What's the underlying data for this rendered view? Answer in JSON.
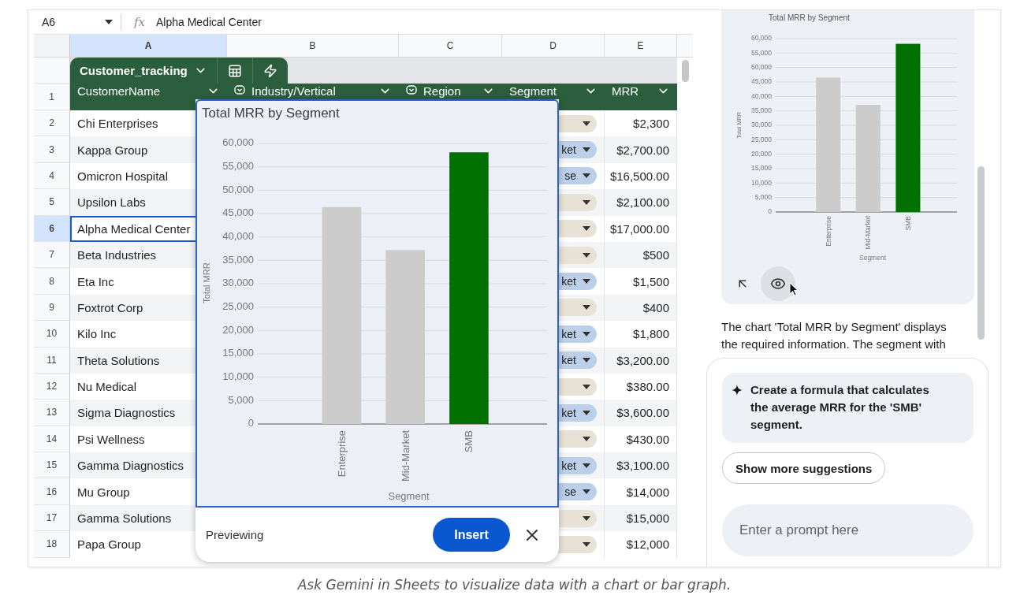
{
  "formula_bar": {
    "cell_ref": "A6",
    "function_label": "fx",
    "formula": "Alpha Medical Center"
  },
  "column_headers": [
    {
      "label": "A",
      "selected": true
    },
    {
      "label": "B",
      "selected": false
    },
    {
      "label": "C",
      "selected": false
    },
    {
      "label": "D",
      "selected": false
    },
    {
      "label": "E",
      "selected": false
    }
  ],
  "table": {
    "name": "Customer_tracking",
    "header_row_number": "1",
    "columns": [
      {
        "label": "CustomerName",
        "kind": "plain"
      },
      {
        "label": "Industry/Vertical",
        "kind": "smart_chip"
      },
      {
        "label": "Region",
        "kind": "smart_chip"
      },
      {
        "label": "Segment",
        "kind": "plain"
      },
      {
        "label": "MRR",
        "kind": "plain"
      }
    ],
    "rows": [
      {
        "number": "2",
        "name": "Chi Enterprises",
        "segment_chip": {
          "color": "#e8e2d6"
        },
        "mrr": "$2,300",
        "selected": false
      },
      {
        "number": "3",
        "name": "Kappa Group",
        "segment_chip": {
          "text": "ket",
          "color": "#bccfe8"
        },
        "mrr": "$2,700.00",
        "selected": false
      },
      {
        "number": "4",
        "name": "Omicron Hospital",
        "segment_chip": {
          "text": "se",
          "color": "#bccfe8"
        },
        "mrr": "$16,500.00",
        "selected": false
      },
      {
        "number": "5",
        "name": "Upsilon Labs",
        "segment_chip": {
          "color": "#e8e2d6"
        },
        "mrr": "$2,100.00",
        "selected": false
      },
      {
        "number": "6",
        "name": "Alpha Medical Center",
        "segment_chip": {
          "color": "#e8e2d6"
        },
        "mrr": "$17,000.00",
        "selected": true
      },
      {
        "number": "7",
        "name": "Beta Industries",
        "segment_chip": {
          "color": "#e8e2d6"
        },
        "mrr": "$500",
        "selected": false
      },
      {
        "number": "8",
        "name": "Eta Inc",
        "segment_chip": {
          "text": "ket",
          "color": "#bccfe8"
        },
        "mrr": "$1,500",
        "selected": false
      },
      {
        "number": "9",
        "name": "Foxtrot Corp",
        "segment_chip": {
          "color": "#e8e2d6"
        },
        "mrr": "$400",
        "selected": false
      },
      {
        "number": "10",
        "name": "Kilo Inc",
        "segment_chip": {
          "text": "ket",
          "color": "#bccfe8"
        },
        "mrr": "$1,800",
        "selected": false
      },
      {
        "number": "11",
        "name": "Theta Solutions",
        "segment_chip": {
          "text": "ket",
          "color": "#bccfe8"
        },
        "mrr": "$3,200.00",
        "selected": false
      },
      {
        "number": "12",
        "name": "Nu Medical",
        "segment_chip": {
          "color": "#e8e2d6"
        },
        "mrr": "$380.00",
        "selected": false
      },
      {
        "number": "13",
        "name": "Sigma Diagnostics",
        "segment_chip": {
          "text": "ket",
          "color": "#bccfe8"
        },
        "mrr": "$3,600.00",
        "selected": false
      },
      {
        "number": "14",
        "name": "Psi Wellness",
        "segment_chip": {
          "color": "#e8e2d6"
        },
        "mrr": "$430.00",
        "selected": false
      },
      {
        "number": "15",
        "name": "Gamma Diagnostics",
        "segment_chip": {
          "text": "ket",
          "color": "#bccfe8"
        },
        "mrr": "$3,100.00",
        "selected": false
      },
      {
        "number": "16",
        "name": "Mu Group",
        "segment_chip": {
          "text": "se",
          "color": "#bccfe8"
        },
        "mrr": "$14,000",
        "selected": false
      },
      {
        "number": "17",
        "name": "Gamma Solutions",
        "segment_chip": {
          "color": "#e8e2d6"
        },
        "mrr": "$15,000",
        "selected": false
      },
      {
        "number": "18",
        "name": "Papa Group",
        "segment_chip": {
          "color": "#e8e2d6"
        },
        "mrr": "$12,000",
        "selected": false
      }
    ]
  },
  "chart_preview": {
    "status": "Previewing",
    "insert_button": "Insert",
    "chart_data": {
      "type": "bar",
      "title": "Total MRR by Segment",
      "xlabel": "Segment",
      "ylabel": "Total MRR",
      "categories": [
        "Enterprise",
        "Mid-Market",
        "SMB"
      ],
      "series": [
        {
          "color": "#cccccc",
          "values": [
            46400,
            37200,
            null
          ]
        },
        {
          "color": "#007000",
          "values": [
            null,
            null,
            58100
          ]
        }
      ],
      "stacked": true,
      "grid": true,
      "ylim": [
        0,
        60000
      ],
      "yticks": [
        {
          "value": 0,
          "label": "0"
        },
        {
          "value": 5000,
          "label": "5,000"
        },
        {
          "value": 10000,
          "label": "10,000"
        },
        {
          "value": 15000,
          "label": "15,000"
        },
        {
          "value": 20000,
          "label": "20,000"
        },
        {
          "value": 25000,
          "label": "25,000"
        },
        {
          "value": 30000,
          "label": "30,000"
        },
        {
          "value": 35000,
          "label": "35,000"
        },
        {
          "value": 40000,
          "label": "40,000"
        },
        {
          "value": 45000,
          "label": "45,000"
        },
        {
          "value": 50000,
          "label": "50,000"
        },
        {
          "value": 55000,
          "label": "55,000"
        },
        {
          "value": 60000,
          "label": "60,000"
        }
      ]
    }
  },
  "side_panel": {
    "chart_card": {
      "chart_data": {
        "type": "bar",
        "title": "Total MRR by Segment",
        "xlabel": "Segment",
        "ylabel": "Total MRR",
        "categories": [
          "Enterprise",
          "Mid-Market",
          "SMB"
        ],
        "series": [
          {
            "color": "#cccccc",
            "values": [
              46500,
              37100,
              null
            ]
          },
          {
            "color": "#007000",
            "values": [
              null,
              null,
              58200
            ]
          }
        ],
        "stacked": true,
        "grid": true,
        "ylim": [
          0,
          60000
        ],
        "yticks": [
          {
            "value": 0,
            "label": "0"
          },
          {
            "value": 5000,
            "label": "5,000"
          },
          {
            "value": 10000,
            "label": "10,000"
          },
          {
            "value": 15000,
            "label": "15,000"
          },
          {
            "value": 20000,
            "label": "20,000"
          },
          {
            "value": 25000,
            "label": "25,000"
          },
          {
            "value": 30000,
            "label": "30,000"
          },
          {
            "value": 35000,
            "label": "35,000"
          },
          {
            "value": 40000,
            "label": "40,000"
          },
          {
            "value": 45000,
            "label": "45,000"
          },
          {
            "value": 50000,
            "label": "50,000"
          },
          {
            "value": 55000,
            "label": "55,000"
          },
          {
            "value": 60000,
            "label": "60,000"
          }
        ]
      }
    },
    "response": "The chart 'Total MRR by Segment' displays the required information. The segment with",
    "suggestion": "Create a formula that calculates the average MRR for the 'SMB' segment.",
    "more_button": "Show more suggestions",
    "prompt": {
      "placeholder": "Enter a prompt here"
    }
  },
  "caption": "Ask Gemini in Sheets to visualize data with a chart or bar graph."
}
